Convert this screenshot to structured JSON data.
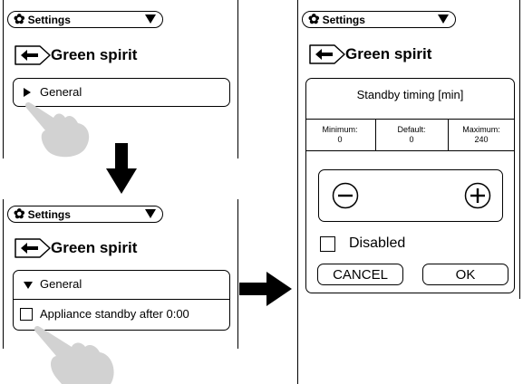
{
  "header": {
    "dropdown_label": "Settings",
    "gear_icon": "gear-icon"
  },
  "screen": {
    "title": "Green spirit"
  },
  "step1": {
    "section_label": "General"
  },
  "step2": {
    "section_label": "General",
    "option_label": "Appliance standby after 0:00"
  },
  "dialog": {
    "title": "Standby timing [min]",
    "minimum_label": "Minimum:",
    "minimum_value": "0",
    "default_label": "Default:",
    "default_value": "0",
    "maximum_label": "Maximum:",
    "maximum_value": "240",
    "disabled_label": "Disabled",
    "cancel_label": "CANCEL",
    "ok_label": "OK"
  }
}
